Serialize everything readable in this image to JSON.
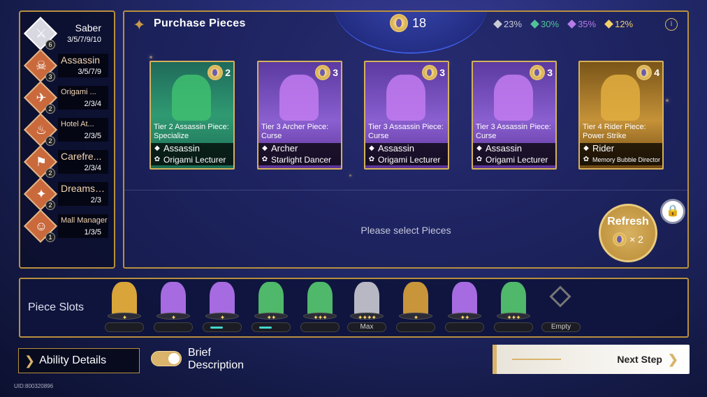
{
  "factions": [
    {
      "name": "Saber",
      "count": "6",
      "tiers": "3/5/7/9/10",
      "icon": "sword-icon",
      "glyph": "⚔"
    },
    {
      "name": "Assassin",
      "count": "3",
      "tiers": "3/5/7/9",
      "icon": "mask-icon",
      "glyph": "☠"
    },
    {
      "name": "Origami ...",
      "count": "2",
      "tiers": "2/3/4",
      "icon": "origami-icon",
      "glyph": "✈"
    },
    {
      "name": "Hotel At...",
      "count": "2",
      "tiers": "2/3/5",
      "icon": "hotel-icon",
      "glyph": "♨"
    },
    {
      "name": "Carefre...",
      "count": "2",
      "tiers": "2/3/4",
      "icon": "banner-icon",
      "glyph": "⚑"
    },
    {
      "name": "Dreamsmith",
      "count": "2",
      "tiers": "2/3",
      "icon": "dreamsmith-icon",
      "glyph": "✦"
    },
    {
      "name": "Mall Manager",
      "count": "1",
      "tiers": "1/3/5",
      "icon": "mall-manager-icon",
      "glyph": "☺"
    }
  ],
  "purchase": {
    "title": "Purchase Pieces",
    "coins": "18",
    "odds": [
      {
        "value": "23%",
        "color": "#c8cbd6"
      },
      {
        "value": "30%",
        "color": "#4fc49a"
      },
      {
        "value": "35%",
        "color": "#b57ce8"
      },
      {
        "value": "12%",
        "color": "#f2cf6a"
      }
    ],
    "hint": "Please select Pieces",
    "refresh_label": "Refresh",
    "refresh_cost": "× 2"
  },
  "cards": [
    {
      "cost": "2",
      "title": "Tier 2 Assassin Piece: Specialize",
      "trait1": "Assassin",
      "trait2": "Origami Lecturer",
      "tier": "green"
    },
    {
      "cost": "3",
      "title": "Tier 3 Archer Piece: Curse",
      "trait1": "Archer",
      "trait2": "Starlight Dancer",
      "tier": "purple"
    },
    {
      "cost": "3",
      "title": "Tier 3 Assassin Piece: Curse",
      "trait1": "Assassin",
      "trait2": "Origami Lecturer",
      "tier": "purple"
    },
    {
      "cost": "3",
      "title": "Tier 3 Assassin Piece: Curse",
      "trait1": "Assassin",
      "trait2": "Origami Lecturer",
      "tier": "purple"
    },
    {
      "cost": "4",
      "title": "Tier 4 Rider Piece: Power Strike",
      "trait1": "Rider",
      "trait2": "Memory Bubble Director",
      "tier": "gold"
    }
  ],
  "slots": {
    "label": "Piece Slots",
    "items": [
      {
        "color": "#d9a53a",
        "stars": "✦",
        "bar": "",
        "fill": 0
      },
      {
        "color": "#a66be0",
        "stars": "✦",
        "bar": "",
        "fill": 0
      },
      {
        "color": "#a66be0",
        "stars": "✦",
        "bar": "",
        "fill": 0.5
      },
      {
        "color": "#4fb86a",
        "stars": "✦✦",
        "bar": "",
        "fill": 0.5
      },
      {
        "color": "#4fb86a",
        "stars": "✦✦✦",
        "bar": "",
        "fill": 0
      },
      {
        "color": "#b8b8c4",
        "stars": "✦✦✦✦",
        "bar": "Max",
        "fill": 0
      },
      {
        "color": "#c9953a",
        "stars": "✦",
        "bar": "",
        "fill": 0
      },
      {
        "color": "#a66be0",
        "stars": "✦✦",
        "bar": "",
        "fill": 0
      },
      {
        "color": "#4fb86a",
        "stars": "✦✦✦",
        "bar": "",
        "fill": 0
      },
      {
        "color": "",
        "stars": "",
        "bar": "Empty",
        "fill": 0
      }
    ]
  },
  "bottom": {
    "ability_label": "Ability Details",
    "brief_label": "Brief Description",
    "next_label": "Next Step"
  },
  "uid": "UID:800320896"
}
